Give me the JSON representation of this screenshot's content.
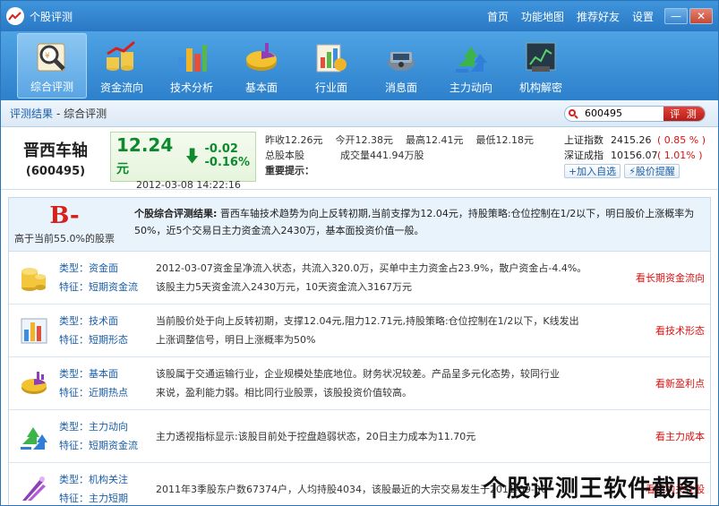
{
  "window": {
    "title": "个股评测",
    "links": [
      "首页",
      "功能地图",
      "推荐好友",
      "设置"
    ],
    "min_label": "—",
    "close_label": "✕"
  },
  "toolbar": {
    "items": [
      {
        "label": "综合评测",
        "icon": "magnifier-icon",
        "active": true
      },
      {
        "label": "资金流向",
        "icon": "coins-chart-icon"
      },
      {
        "label": "技术分析",
        "icon": "bar-chart-icon"
      },
      {
        "label": "基本面",
        "icon": "pie-chart-icon"
      },
      {
        "label": "行业面",
        "icon": "industry-chart-icon"
      },
      {
        "label": "消息面",
        "icon": "news-icon"
      },
      {
        "label": "主力动向",
        "icon": "arrows-icon"
      },
      {
        "label": "机构解密",
        "icon": "institution-chart-icon"
      }
    ]
  },
  "breadcrumb": {
    "link": "评测结果",
    "current": "- 综合评测"
  },
  "search": {
    "value": "600495",
    "button": "评 测"
  },
  "quote": {
    "name": "晋西车轴",
    "code": "(600495)",
    "price": "12.24",
    "price_unit": "元",
    "change": "-0.02",
    "change_pct": "-0.16%",
    "time": "2012-03-08 14:22:16",
    "prev_close": "昨收12.26元",
    "open": "今开12.38元",
    "high": "最高12.41元",
    "low": "最低12.18元",
    "total_shares": "总股本股",
    "volume": "成交量441.94万股",
    "tip": "重要提示：",
    "indices": [
      {
        "name": "上证指数",
        "value": "2415.26",
        "pct": "( 0.85 % )"
      },
      {
        "name": "深证成指",
        "value": "10156.07",
        "pct": "( 1.01% )"
      }
    ],
    "add_watch": "+加入自选",
    "alert": "⚡股价提醒"
  },
  "summary": {
    "grade": "B-",
    "grade_note": "高于当前55.0%的股票",
    "title": "个股综合评测结果:",
    "text": " 晋西车轴技术趋势为向上反转初期,当前支撑为12.04元，持股策略:仓位控制在1/2以下，明日股价上涨概率为50%，近5个交易日主力资金流入2430万，基本面投资价值一般。"
  },
  "items": [
    {
      "type": "类型：资金面",
      "feature": "特征：短期资金流",
      "line1": "2012-03-07资金呈净流入状态，共流入320.0万，买单中主力资金占23.9%，散户资金占-4.4%。",
      "line2": "该股主力5天资金流入2430万元，10天资金流入3167万元",
      "link": "看长期资金流向",
      "icon": "coins-icon"
    },
    {
      "type": "类型：技术面",
      "feature": "特征：短期形态",
      "line1": "当前股价处于向上反转初期，支撑12.04元,阻力12.71元,持股策略:仓位控制在1/2以下，K线发出",
      "line2": "上涨调整信号，明日上涨概率为50%",
      "link": "看技术形态",
      "icon": "bars-icon"
    },
    {
      "type": "类型：基本面",
      "feature": "特征：近期热点",
      "line1": "该股属于交通运输行业，企业规模处垫底地位。财务状况较差。产品呈多元化态势，较同行业",
      "line2": "来说，盈利能力弱。相比同行业股票，该股投资价值较高。",
      "link": "看新盈利点",
      "icon": "pie-icon"
    },
    {
      "type": "类型：主力动向",
      "feature": "特征：短期资金流",
      "line1": "主力透视指标显示:该股目前处于控盘趋弱状态，20日主力成本为11.70元",
      "line2": "",
      "link": "看主力成本",
      "icon": "arrows-icon"
    },
    {
      "type": "类型：机构关注",
      "feature": "特征：主力短期",
      "line1": "2011年3季股东户数67374户，人均持股4034，该股最近的大宗交易发生于2011-09-30",
      "line2": "",
      "link": "看机构关注股",
      "icon": "institution-icon"
    }
  ],
  "watermark": "个股评测王软件截图",
  "colors": {
    "accent": "#2a78c4",
    "down": "#0d8a2e",
    "up": "#dd1111",
    "grade": "#d8201a"
  }
}
